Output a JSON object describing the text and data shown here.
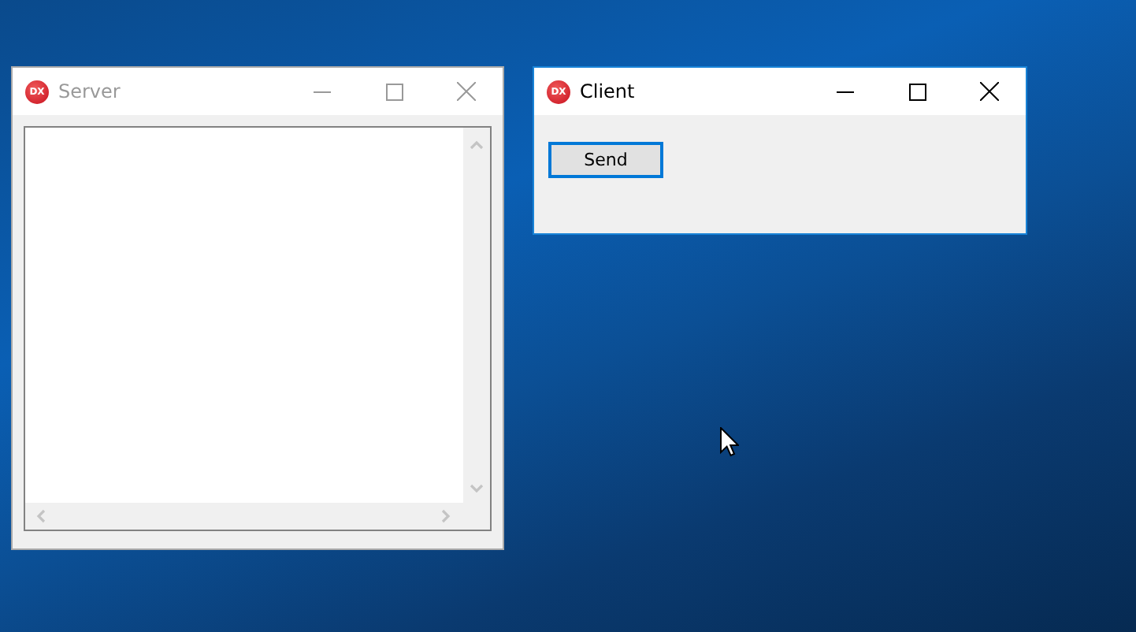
{
  "desktop": {
    "windows": [
      {
        "kind": "log",
        "title": "Server",
        "logo": "DX",
        "active": false
      },
      {
        "kind": "form",
        "title": "Client",
        "logo": "DX",
        "active": true,
        "buttons": [
          {
            "label": "Send",
            "focused": true
          }
        ]
      }
    ]
  }
}
